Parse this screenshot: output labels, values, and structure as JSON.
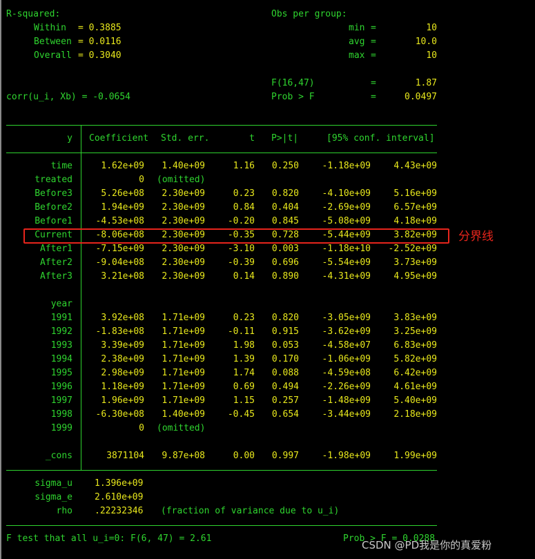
{
  "fit": {
    "r_squared_label": "R-squared:",
    "within_label": "Within",
    "within_value": "= 0.3885",
    "between_label": "Between",
    "between_value": "= 0.0116",
    "overall_label": "Overall",
    "overall_value": "= 0.3040",
    "obs_per_group_label": "Obs per group:",
    "min_label": "min",
    "min_value": "10",
    "avg_label": "avg",
    "avg_value": "10.0",
    "max_label": "max",
    "max_value": "10",
    "eq": "=",
    "f_label": "F(16,47)",
    "f_value": "1.87",
    "prob_label": "Prob > F",
    "prob_value": "0.0497",
    "corr_text": "corr(u_i, Xb) = -0.0654"
  },
  "table": {
    "headers": {
      "y": "y",
      "coef": "Coefficient",
      "se": "Std. err.",
      "t": "t",
      "p": "P>|t|",
      "ci": "[95% conf. interval]"
    },
    "rows": [
      {
        "label": "time",
        "coef": "1.62e+09",
        "se": "1.40e+09",
        "t": "1.16",
        "p": "0.250",
        "lo": "-1.18e+09",
        "hi": "4.43e+09"
      },
      {
        "label": "treated",
        "coef": "0",
        "se": "(omitted)",
        "t": "",
        "p": "",
        "lo": "",
        "hi": ""
      },
      {
        "label": "Before3",
        "coef": "5.26e+08",
        "se": "2.30e+09",
        "t": "0.23",
        "p": "0.820",
        "lo": "-4.10e+09",
        "hi": "5.16e+09"
      },
      {
        "label": "Before2",
        "coef": "1.94e+09",
        "se": "2.30e+09",
        "t": "0.84",
        "p": "0.404",
        "lo": "-2.69e+09",
        "hi": "6.57e+09"
      },
      {
        "label": "Before1",
        "coef": "-4.53e+08",
        "se": "2.30e+09",
        "t": "-0.20",
        "p": "0.845",
        "lo": "-5.08e+09",
        "hi": "4.18e+09"
      },
      {
        "label": "Current",
        "coef": "-8.06e+08",
        "se": "2.30e+09",
        "t": "-0.35",
        "p": "0.728",
        "lo": "-5.44e+09",
        "hi": "3.82e+09"
      },
      {
        "label": "After1",
        "coef": "-7.15e+09",
        "se": "2.30e+09",
        "t": "-3.10",
        "p": "0.003",
        "lo": "-1.18e+10",
        "hi": "-2.52e+09"
      },
      {
        "label": "After2",
        "coef": "-9.04e+08",
        "se": "2.30e+09",
        "t": "-0.39",
        "p": "0.696",
        "lo": "-5.54e+09",
        "hi": "3.73e+09"
      },
      {
        "label": "After3",
        "coef": "3.21e+08",
        "se": "2.30e+09",
        "t": "0.14",
        "p": "0.890",
        "lo": "-4.31e+09",
        "hi": "4.95e+09"
      },
      {
        "label": "",
        "coef": "",
        "se": "",
        "t": "",
        "p": "",
        "lo": "",
        "hi": ""
      },
      {
        "label": "year",
        "coef": "",
        "se": "",
        "t": "",
        "p": "",
        "lo": "",
        "hi": ""
      },
      {
        "label": "1991",
        "coef": "3.92e+08",
        "se": "1.71e+09",
        "t": "0.23",
        "p": "0.820",
        "lo": "-3.05e+09",
        "hi": "3.83e+09"
      },
      {
        "label": "1992",
        "coef": "-1.83e+08",
        "se": "1.71e+09",
        "t": "-0.11",
        "p": "0.915",
        "lo": "-3.62e+09",
        "hi": "3.25e+09"
      },
      {
        "label": "1993",
        "coef": "3.39e+09",
        "se": "1.71e+09",
        "t": "1.98",
        "p": "0.053",
        "lo": "-4.58e+07",
        "hi": "6.83e+09"
      },
      {
        "label": "1994",
        "coef": "2.38e+09",
        "se": "1.71e+09",
        "t": "1.39",
        "p": "0.170",
        "lo": "-1.06e+09",
        "hi": "5.82e+09"
      },
      {
        "label": "1995",
        "coef": "2.98e+09",
        "se": "1.71e+09",
        "t": "1.74",
        "p": "0.088",
        "lo": "-4.59e+08",
        "hi": "6.42e+09"
      },
      {
        "label": "1996",
        "coef": "1.18e+09",
        "se": "1.71e+09",
        "t": "0.69",
        "p": "0.494",
        "lo": "-2.26e+09",
        "hi": "4.61e+09"
      },
      {
        "label": "1997",
        "coef": "1.96e+09",
        "se": "1.71e+09",
        "t": "1.15",
        "p": "0.257",
        "lo": "-1.48e+09",
        "hi": "5.40e+09"
      },
      {
        "label": "1998",
        "coef": "-6.30e+08",
        "se": "1.40e+09",
        "t": "-0.45",
        "p": "0.654",
        "lo": "-3.44e+09",
        "hi": "2.18e+09"
      },
      {
        "label": "1999",
        "coef": "0",
        "se": "(omitted)",
        "t": "",
        "p": "",
        "lo": "",
        "hi": ""
      },
      {
        "label": "",
        "coef": "",
        "se": "",
        "t": "",
        "p": "",
        "lo": "",
        "hi": ""
      },
      {
        "label": "_cons",
        "coef": "3871104",
        "se": "9.87e+08",
        "t": "0.00",
        "p": "0.997",
        "lo": "-1.98e+09",
        "hi": "1.99e+09"
      }
    ]
  },
  "sigma": {
    "sigma_u_label": "sigma_u",
    "sigma_u_value": "1.396e+09",
    "sigma_e_label": "sigma_e",
    "sigma_e_value": "2.610e+09",
    "rho_label": "rho",
    "rho_value": ".22232346",
    "rho_note": "(fraction of variance due to u_i)"
  },
  "ftest": {
    "text": "F test that all u_i=0: F(6, 47) = 2.61",
    "prob_text": "Prob > F = 0.0288"
  },
  "annotation": {
    "label": "分界线",
    "color": "#e8251c"
  },
  "watermark": "CSDN @PD我是你的真爱粉",
  "colors": {
    "background": "#000000",
    "label_green": "#2fd52f",
    "value_yellow": "#e8e81c"
  }
}
